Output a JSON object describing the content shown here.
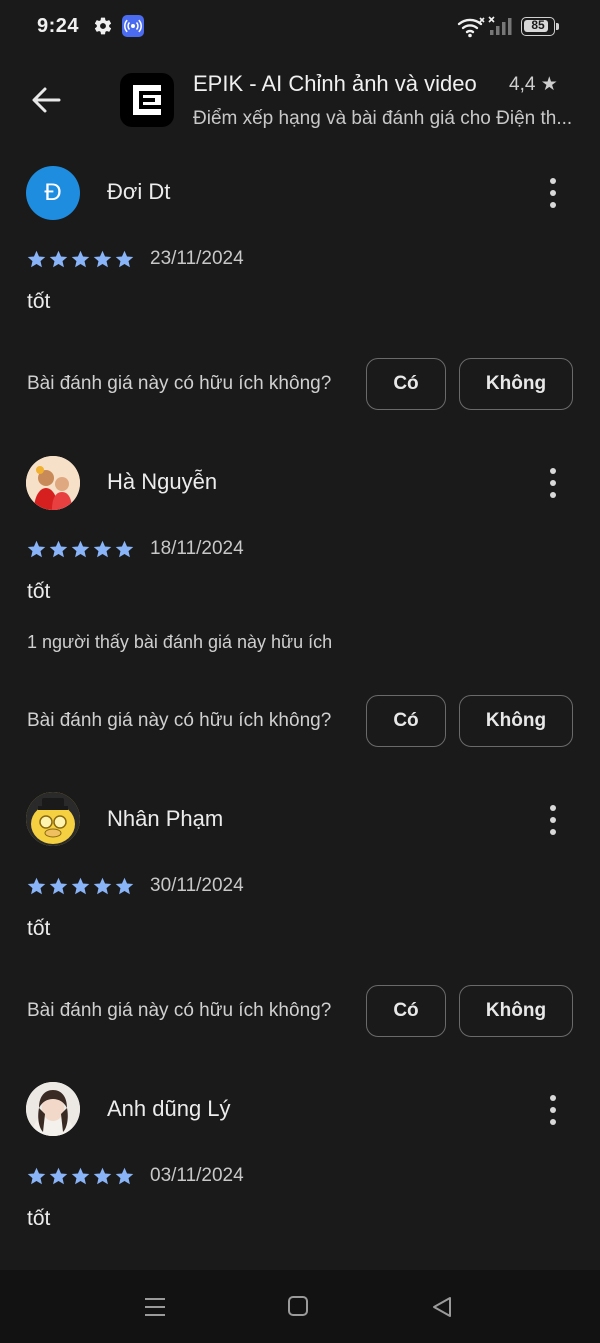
{
  "status_bar": {
    "time": "9:24",
    "battery": "85",
    "battery_level": 0.85,
    "icons": [
      "gear-icon",
      "radio-icon",
      "wifi-icon",
      "signal-icon",
      "battery-icon"
    ]
  },
  "header": {
    "app_name": "EPIK - AI Chỉnh ảnh và video",
    "rating": "4,4 ★",
    "subtitle": "Điểm xếp hạng và bài đánh giá cho Điện th..."
  },
  "helpful_question": "Bài đánh giá này có hữu ích không?",
  "yes_label": "Có",
  "no_label": "Không",
  "star_color": "#8ab4f8",
  "reviews": [
    {
      "name": "Đơi Dt",
      "initial": "Đ",
      "rating": 5,
      "date": "23/11/2024",
      "text": "tốt"
    },
    {
      "name": "Hà Nguyễn",
      "rating": 5,
      "date": "18/11/2024",
      "text": "tốt",
      "helpful_count": "1 người thấy bài đánh giá này hữu ích"
    },
    {
      "name": "Nhân Phạm",
      "rating": 5,
      "date": "30/11/2024",
      "text": "tốt"
    },
    {
      "name": "Anh dũng Lý",
      "rating": 5,
      "date": "03/11/2024",
      "text": "tốt"
    }
  ]
}
